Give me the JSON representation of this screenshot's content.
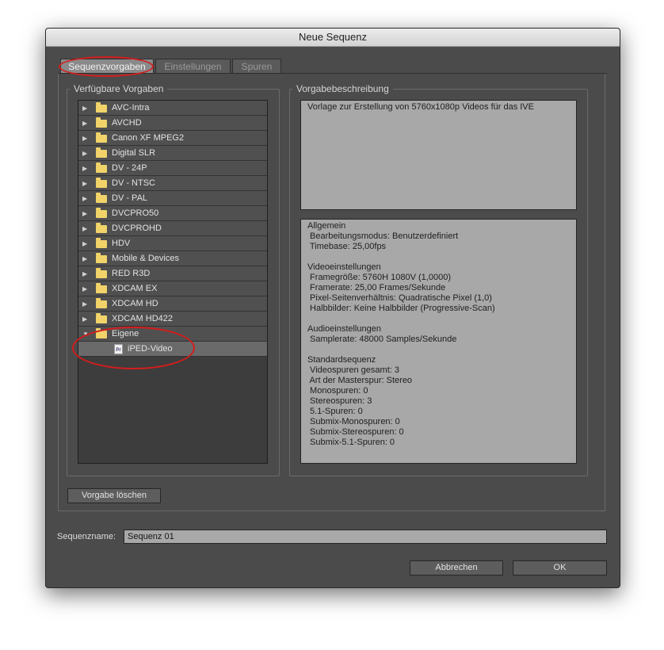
{
  "window": {
    "title": "Neue Sequenz"
  },
  "tabs": [
    {
      "label": "Sequenzvorgaben",
      "active": true
    },
    {
      "label": "Einstellungen",
      "active": false
    },
    {
      "label": "Spuren",
      "active": false
    }
  ],
  "presets": {
    "title": "Verfügbare Vorgaben",
    "folders": [
      "AVC-Intra",
      "AVCHD",
      "Canon XF MPEG2",
      "Digital SLR",
      "DV - 24P",
      "DV - NTSC",
      "DV - PAL",
      "DVCPRO50",
      "DVCPROHD",
      "HDV",
      "Mobile & Devices",
      "RED R3D",
      "XDCAM EX",
      "XDCAM HD",
      "XDCAM HD422"
    ],
    "expanded_folder": "Eigene",
    "expanded_child": "iPED-Video",
    "child_icon_text": "Pr",
    "delete_button": "Vorgabe löschen"
  },
  "description": {
    "title": "Vorgabebeschreibung",
    "text": "Vorlage zur Erstellung von 5760x1080p Videos für das IVE",
    "details": [
      "Allgemein",
      " Bearbeitungsmodus: Benutzerdefiniert",
      " Timebase: 25,00fps",
      "",
      "Videoeinstellungen",
      " Framegröße: 5760H 1080V (1,0000)",
      " Framerate: 25,00 Frames/Sekunde",
      " Pixel-Seitenverhältnis: Quadratische Pixel (1,0)",
      " Halbbilder: Keine Halbbilder (Progressive-Scan)",
      "",
      "Audioeinstellungen",
      " Samplerate: 48000 Samples/Sekunde",
      "",
      "Standardsequenz",
      " Videospuren gesamt: 3",
      " Art der Masterspur: Stereo",
      " Monospuren: 0",
      " Stereospuren: 3",
      " 5.1-Spuren: 0",
      " Submix-Monospuren: 0",
      " Submix-Stereospuren: 0",
      " Submix-5.1-Spuren: 0"
    ]
  },
  "sequence": {
    "name_label": "Sequenzname:",
    "name_value": "Sequenz 01"
  },
  "buttons": {
    "cancel": "Abbrechen",
    "ok": "OK"
  },
  "colors": {
    "highlight_ellipse": "#d31d1d",
    "folder": "#f1d36a"
  }
}
